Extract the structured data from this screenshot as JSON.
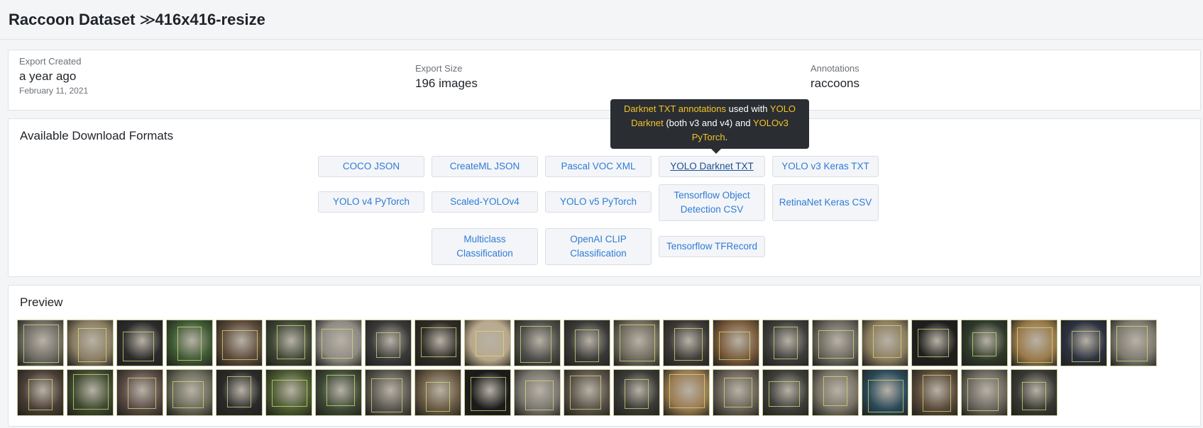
{
  "header": {
    "dataset": "Raccoon Dataset",
    "separator": "≫",
    "version": "416x416-resize"
  },
  "export": {
    "created_label": "Export Created",
    "created_value": "a year ago",
    "created_date": "February 11, 2021",
    "size_label": "Export Size",
    "size_value": "196 images",
    "annotations_label": "Annotations",
    "annotations_value": "raccoons"
  },
  "formats": {
    "title": "Available Download Formats",
    "items": [
      "COCO JSON",
      "CreateML JSON",
      "Pascal VOC XML",
      "YOLO Darknet TXT",
      "YOLO v3 Keras TXT",
      "YOLO v4 PyTorch",
      "Scaled-YOLOv4",
      "YOLO v5 PyTorch",
      "Tensorflow Object Detection CSV",
      "RetinaNet Keras CSV",
      "Multiclass Classification",
      "OpenAI CLIP Classification",
      "Tensorflow TFRecord"
    ],
    "active_index": 3
  },
  "tooltip": {
    "part1": "Darknet TXT annotations",
    "part2": " used with ",
    "part3": "YOLO Darknet",
    "part4": " (both v3 and v4) and ",
    "part5": "YOLOv3 PyTorch",
    "part6": "."
  },
  "preview": {
    "title": "Preview",
    "thumbnail_count": 44,
    "thumbnail_colors": [
      "#6d6a63",
      "#8a7d63",
      "#2b2b2b",
      "#3e5a34",
      "#5d4a3a",
      "#3f4736",
      "#8e8a84",
      "#3a3a3a",
      "#2e2b27",
      "#b9a88c",
      "#4d4d49",
      "#3a3a38",
      "#6f6a5e",
      "#3d3a38",
      "#7a5a3b",
      "#3e3e3c",
      "#6b6860",
      "#8c7d5f",
      "#1f1e1d",
      "#2f3a2a",
      "#9a7a4a",
      "#2d3240",
      "#7d7a70",
      "#4b3e36",
      "#3e4a2f",
      "#5a4a44",
      "#6a6a5a",
      "#2a2a2a",
      "#4a5a30",
      "#3e4a36",
      "#5a5650",
      "#6a5a44",
      "#1a1a1a",
      "#7a7670",
      "#5a5248",
      "#3a3a36",
      "#9a7a50",
      "#6a6258",
      "#3e3e3a",
      "#7a7468",
      "#2a4a5a",
      "#5a4a3a",
      "#6a665e",
      "#3a3a34",
      "#4a5a3a"
    ]
  }
}
